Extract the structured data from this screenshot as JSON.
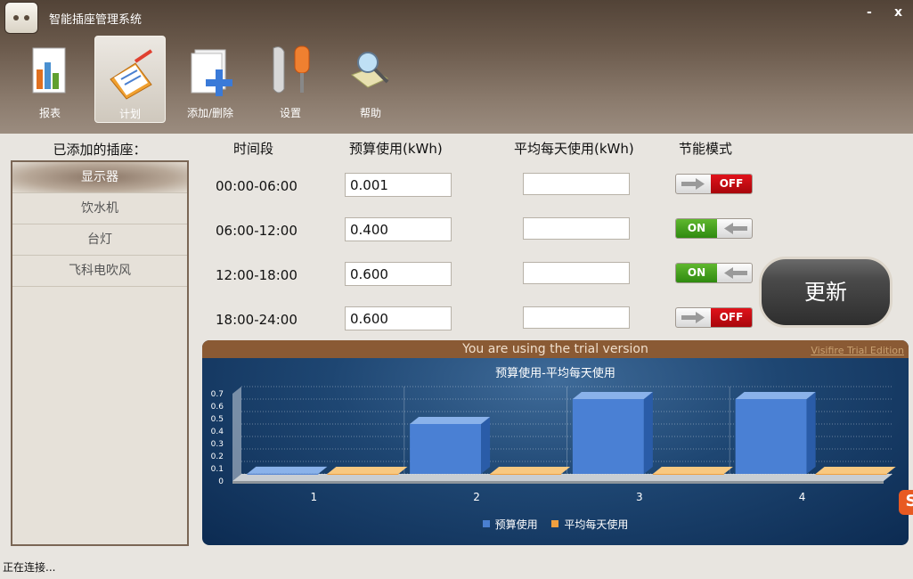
{
  "app": {
    "title": "智能插座管理系统",
    "minimize": "-",
    "close": "x"
  },
  "toolbar": [
    {
      "label": "报表",
      "icon": "report-icon"
    },
    {
      "label": "计划",
      "icon": "plan-icon",
      "active": true
    },
    {
      "label": "添加/删除",
      "icon": "add-remove-icon"
    },
    {
      "label": "设置",
      "icon": "settings-icon"
    },
    {
      "label": "帮助",
      "icon": "help-icon"
    }
  ],
  "sidebar": {
    "title": "已添加的插座：",
    "items": [
      "显示器",
      "饮水机",
      "台灯",
      "飞科电吹风"
    ],
    "selected_index": 0
  },
  "table": {
    "headers": {
      "period": "时间段",
      "budget": "预算使用(kWh)",
      "avg": "平均每天使用(kWh)",
      "mode": "节能模式"
    },
    "rows": [
      {
        "period": "00:00-06:00",
        "budget": "0.001",
        "avg": "",
        "mode": "OFF"
      },
      {
        "period": "06:00-12:00",
        "budget": "0.400",
        "avg": "",
        "mode": "ON"
      },
      {
        "period": "12:00-18:00",
        "budget": "0.600",
        "avg": "",
        "mode": "ON"
      },
      {
        "period": "18:00-24:00",
        "budget": "0.600",
        "avg": "",
        "mode": "OFF"
      }
    ],
    "update_label": "更新"
  },
  "chart_banner": {
    "trial_text": "You are using the trial version",
    "trial_link": "Visifire Trial Edition"
  },
  "chart_data": {
    "type": "bar",
    "title": "预算使用-平均每天使用",
    "categories": [
      "1",
      "2",
      "3",
      "4"
    ],
    "series": [
      {
        "name": "预算使用",
        "values": [
          0.001,
          0.4,
          0.6,
          0.6
        ],
        "color": "#4a7fd0"
      },
      {
        "name": "平均每天使用",
        "values": [
          0,
          0,
          0,
          0
        ],
        "color": "#f0a040"
      }
    ],
    "y_ticks": [
      "0",
      "0.1",
      "0.2",
      "0.3",
      "0.4",
      "0.5",
      "0.6",
      "0.7"
    ],
    "ylim": [
      0,
      0.7
    ],
    "grid": true,
    "legend_position": "bottom"
  },
  "status": "正在连接..."
}
